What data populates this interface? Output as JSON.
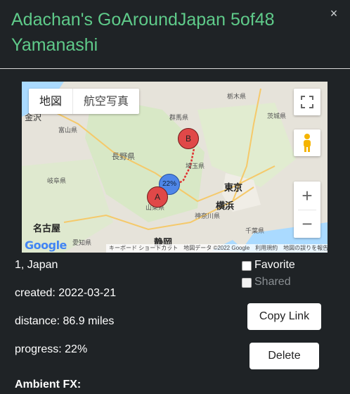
{
  "header": {
    "title_line1": "Adachan's GoAroundJapan 5of48",
    "title_line2": "Yamanashi",
    "close_glyph": "×"
  },
  "map": {
    "type_buttons": [
      "地図",
      "航空写真"
    ],
    "labels": {
      "kanazawa": "金沢",
      "toyama": "富山県",
      "gifu": "岐阜県",
      "nagano": "長野県",
      "gunma": "群馬県",
      "tochigi": "栃木県",
      "ibaraki": "茨城県",
      "saitama": "埼玉県",
      "tokyo": "東京",
      "yokohama": "横浜",
      "kanagawa": "神奈川県",
      "yamanashi": "山梨県",
      "chiba": "千葉県",
      "nagoya": "名古屋",
      "shizuoka": "静岡",
      "aichi": "愛知県"
    },
    "markers": {
      "start": "A",
      "end": "B",
      "progress": "22%"
    },
    "logo": "Google",
    "footer": "キーボード ショートカット　地図データ ©2022 Google　利用規約　地図の誤りを報告する",
    "icons": {
      "fullscreen": "fullscreen-icon",
      "pegman": "pegman-icon",
      "zoom_in": "+",
      "zoom_out": "−"
    }
  },
  "details": {
    "location": "1, Japan",
    "created": "created: 2022-03-21",
    "distance": "distance: 86.9 miles",
    "progress": "progress: 22%",
    "progress_value": 0.22,
    "ambient_fx": "Ambient FX:"
  },
  "options": {
    "favorite_label": "Favorite",
    "shared_label": "Shared"
  },
  "buttons": {
    "copy_link": "Copy Link",
    "delete": "Delete"
  },
  "colors": {
    "background": "#1f2326",
    "title": "#5fcb8a",
    "route": "#e03030",
    "marker_red": "#e04848",
    "marker_blue": "#4f86e8"
  }
}
